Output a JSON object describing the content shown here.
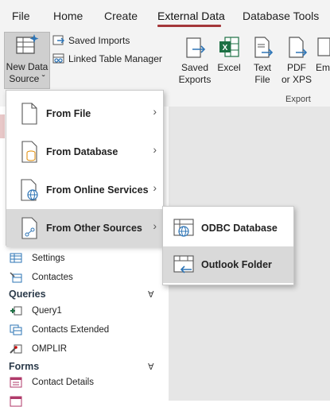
{
  "ribbon_tabs": [
    {
      "label": "File"
    },
    {
      "label": "Home"
    },
    {
      "label": "Create"
    },
    {
      "label": "External Data"
    },
    {
      "label": "Database Tools"
    }
  ],
  "ribbon": {
    "new_data_source": {
      "line1": "New Data",
      "line2": "Source ˇ"
    },
    "saved_imports": "Saved Imports",
    "linked_table_manager": "Linked Table Manager",
    "saved_exports": {
      "line1": "Saved",
      "line2": "Exports"
    },
    "excel": "Excel",
    "text_file": {
      "line1": "Text",
      "line2": "File"
    },
    "pdf_xps": {
      "line1": "PDF",
      "line2": "or XPS"
    },
    "email_partial": "Em",
    "export_group": "Export"
  },
  "new_source_menu": [
    {
      "label": "From File"
    },
    {
      "label": "From Database"
    },
    {
      "label": "From Online Services"
    },
    {
      "label": "From Other Sources"
    }
  ],
  "other_sources_submenu": [
    {
      "label": "ODBC Database"
    },
    {
      "label": "Outlook Folder"
    }
  ],
  "nav": {
    "items_top": [
      "Settings",
      "Contactes"
    ],
    "queries_header": "Queries",
    "queries": [
      "Query1",
      "Contacts Extended",
      "OMPLIR"
    ],
    "forms_header": "Forms",
    "forms": [
      "Contact Details"
    ],
    "collapse_glyph": "Ɐ"
  },
  "colors": {
    "accent": "#a4373a",
    "excel_green": "#1d7044",
    "highlight": "#d9d9d9",
    "link_blue": "#2e75b6"
  }
}
